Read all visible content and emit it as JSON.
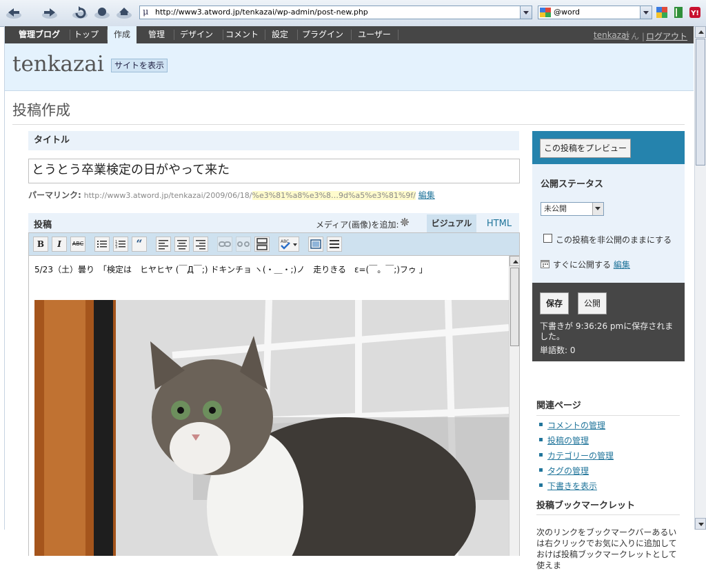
{
  "browser": {
    "url": "http://www3.atword.jp/tenkazai/wp-admin/post-new.php",
    "search_value": "@word"
  },
  "admin_nav": {
    "items": [
      "管理ブログ",
      "トップ",
      "作成",
      "管理",
      "デザイン",
      "コメント",
      "設定",
      "プラグイン",
      "ユーザー"
    ],
    "active_index": 2,
    "user_name": "tenkazai",
    "user_suffix": "さん",
    "separator": "|",
    "logout": "ログアウト"
  },
  "site": {
    "title": "tenkazai",
    "view_site_button": "サイトを表示"
  },
  "page_title": "投稿作成",
  "title_panel": {
    "heading": "タイトル",
    "value": "とうとう卒業検定の日がやって来た"
  },
  "permalink": {
    "label": "パーマリンク:",
    "base": "http://www3.atword.jp/tenkazai/2009/06/18/",
    "slug": "%e3%81%a8%e3%8…9d%a5%e3%81%9f/",
    "edit": "編集"
  },
  "post_panel": {
    "heading": "投稿",
    "media_label": "メディア(画像)を追加:",
    "tab_visual": "ビジュアル",
    "tab_html": "HTML",
    "content_text": "5/23（土）曇り　「検定は　ヒヤヒヤ (￣Д￣;)  ドキンチョ ヽ(・＿・;)ノ　走りきる　ε=(￣。￣;)フゥ 」"
  },
  "toolbar_buttons": [
    {
      "name": "bold-button",
      "glyph": "B"
    },
    {
      "name": "italic-button",
      "glyph": "I"
    },
    {
      "name": "strikethrough-button",
      "glyph": "ABC"
    },
    {
      "name": "bulleted-list-button",
      "glyph": "ul"
    },
    {
      "name": "numbered-list-button",
      "glyph": "ol"
    },
    {
      "name": "blockquote-button",
      "glyph": "“"
    },
    {
      "name": "align-left-button",
      "glyph": "al"
    },
    {
      "name": "align-center-button",
      "glyph": "ac"
    },
    {
      "name": "align-right-button",
      "glyph": "ar"
    },
    {
      "name": "insert-link-button",
      "glyph": "link"
    },
    {
      "name": "unlink-button",
      "glyph": "unlink"
    },
    {
      "name": "insert-more-button",
      "glyph": "more"
    },
    {
      "name": "spellcheck-button",
      "glyph": "spell"
    },
    {
      "name": "fullscreen-button",
      "glyph": "full"
    },
    {
      "name": "kitchen-sink-button",
      "glyph": "sink"
    }
  ],
  "publish_box": {
    "preview_button": "この投稿をプレビュー",
    "status_title": "公開ステータス",
    "status_value": "未公開",
    "private_checkbox_label": "この投稿を非公開のままにする",
    "schedule_label": "すぐに公開する",
    "schedule_edit": "編集",
    "save_button": "保存",
    "publish_button": "公開",
    "draft_saved_text": "下書きが 9:36:26 pmに保存されました。",
    "word_count": "単語数: 0"
  },
  "related": {
    "title": "関連ページ",
    "links": [
      "コメントの管理",
      "投稿の管理",
      "カテゴリーの管理",
      "タグの管理",
      "下書きを表示"
    ]
  },
  "bookmarklet": {
    "title": "投稿ブックマークレット",
    "text": "次のリンクをブックマークバーあるいは右クリックでお気に入りに追加しておけば投稿ブックマークレットとして使えま"
  },
  "colors": {
    "admin_bar": "#464646",
    "header_bg": "#e4f2fd",
    "link": "#21759b",
    "publish_blue": "#2583ad"
  }
}
